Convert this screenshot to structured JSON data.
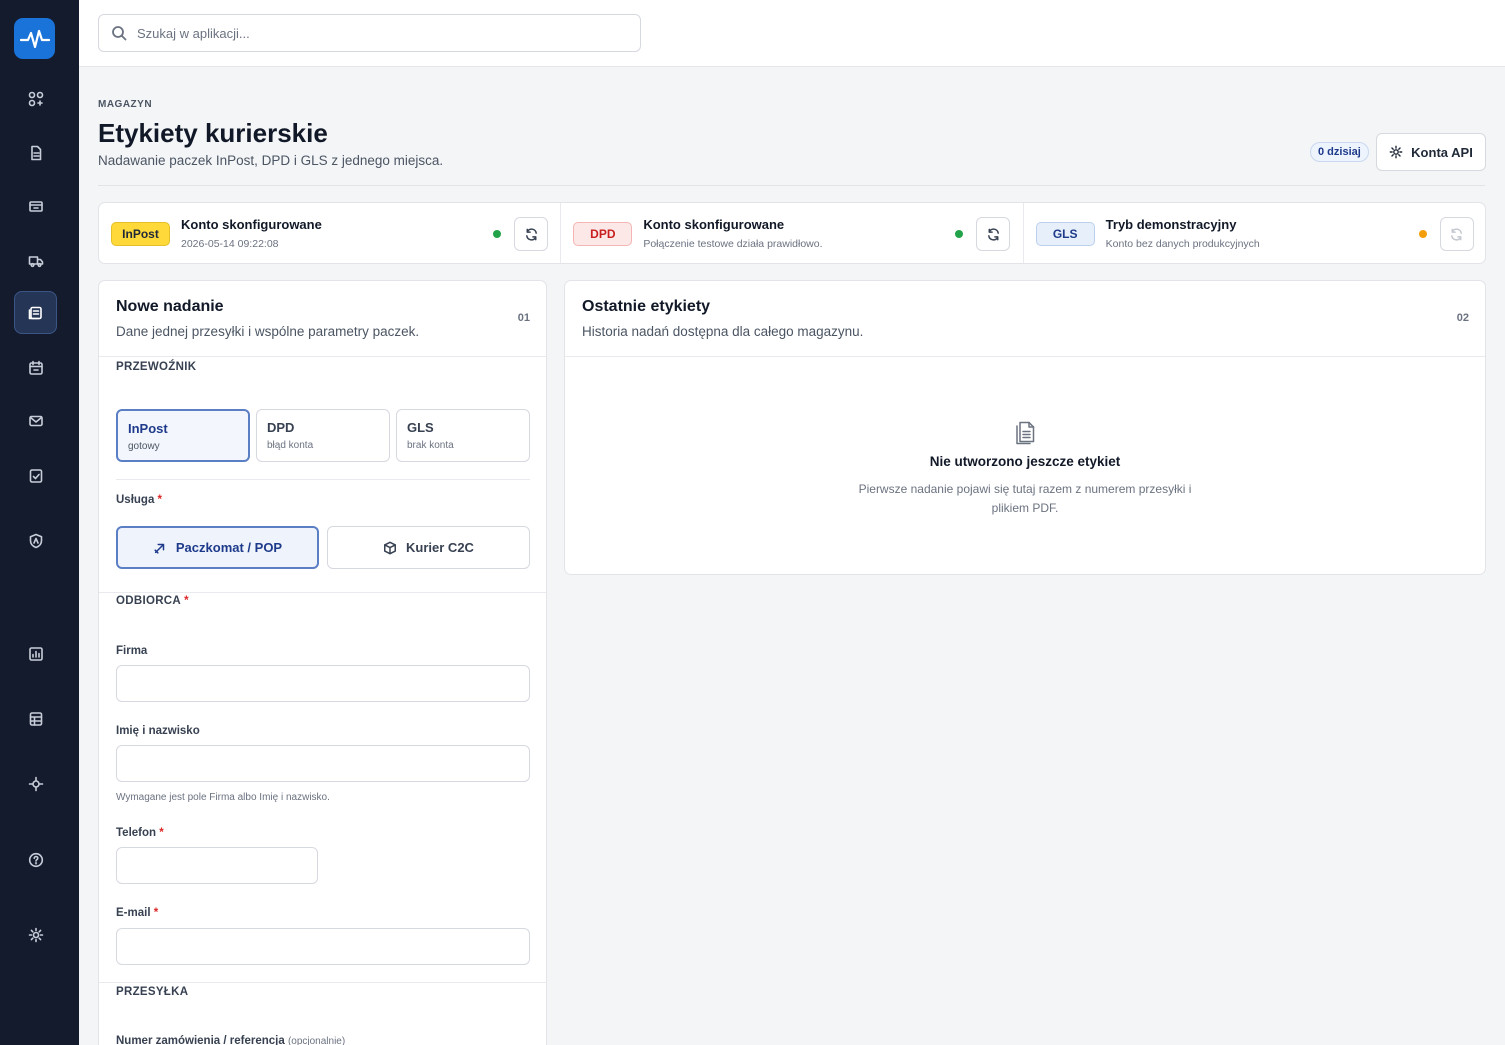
{
  "search": {
    "placeholder": "Szukaj w aplikacji..."
  },
  "header": {
    "eyebrow": "MAGAZYN",
    "title": "Etykiety kurierskie",
    "subtitle": "Nadawanie paczek InPost, DPD i GLS z jednego miejsca.",
    "today_badge": "0 dzisiaj",
    "api_button": "Konta API"
  },
  "status": [
    {
      "logo": "InPost",
      "title": "Konto skonfigurowane",
      "desc": "2026-05-14 09:22:08",
      "dot": "green"
    },
    {
      "logo": "DPD",
      "title": "Konto skonfigurowane",
      "desc": "Połączenie testowe działa prawidłowo.",
      "dot": "green"
    },
    {
      "logo": "GLS",
      "title": "Tryb demonstracyjny",
      "desc": "Konto bez danych produkcyjnych",
      "dot": "orange"
    }
  ],
  "form": {
    "title": "Nowe nadanie",
    "subtitle": "Dane jednej przesyłki i wspólne parametry paczek.",
    "num": "01",
    "carrier_label": "PRZEWOŹNIK",
    "carriers": [
      {
        "name": "InPost",
        "state": "gotowy"
      },
      {
        "name": "DPD",
        "state": "błąd konta"
      },
      {
        "name": "GLS",
        "state": "brak konta"
      }
    ],
    "service_label": "Usługa",
    "services": [
      "Paczkomat / POP",
      "Kurier C2C"
    ],
    "recipient_label": "ODBIORCA",
    "company_label": "Firma",
    "name_label": "Imię i nazwisko",
    "name_hint": "Wymagane jest pole Firma albo Imię i nazwisko.",
    "phone_label": "Telefon",
    "email_label": "E-mail",
    "shipment_label": "PRZESYŁKA",
    "order_label": "Numer zamówienia / referencja",
    "order_optional": "(opcjonalnie)",
    "required_mark": "*"
  },
  "results": {
    "title": "Ostatnie etykiety",
    "subtitle": "Historia nadań dostępna dla całego magazynu.",
    "num": "02",
    "empty_title": "Nie utworzono jeszcze etykiet",
    "empty_desc": "Pierwsze nadanie pojawi się tutaj razem z numerem przesyłki i plikiem PDF."
  },
  "colors": {
    "sidebar": "#141b2d",
    "accent": "#1a73d9",
    "status_ok": "#22a34a",
    "status_warn": "#f59e0b",
    "required": "#dc2626"
  },
  "icons": {
    "sidebar": [
      "dashboard-icon",
      "document-icon",
      "inventory-icon",
      "truck-icon",
      "labels-icon",
      "calendar-icon",
      "mail-icon",
      "checklist-icon",
      "shield-icon",
      "chart-icon",
      "table-icon",
      "integrations-icon",
      "help-icon",
      "settings-icon"
    ]
  }
}
